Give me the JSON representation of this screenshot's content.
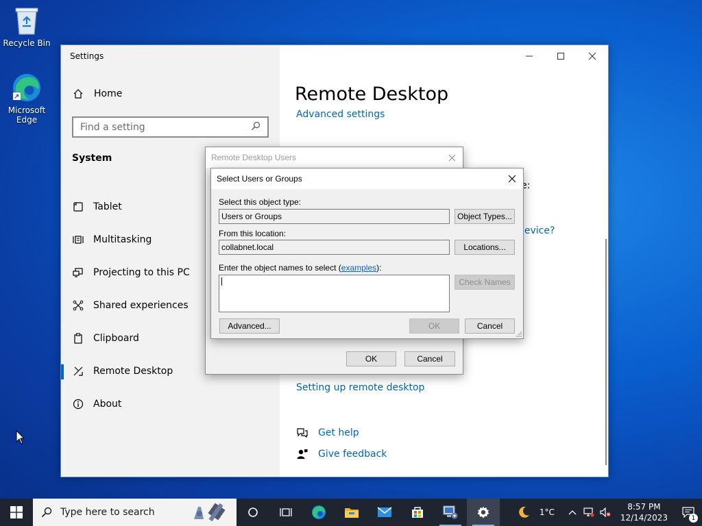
{
  "desktop": {
    "icons": [
      {
        "label": "Recycle Bin"
      },
      {
        "label": "Microsoft Edge"
      }
    ]
  },
  "settings": {
    "app_title": "Settings",
    "home_label": "Home",
    "search_placeholder": "Find a setting",
    "section": "System",
    "nav": [
      {
        "label": "Tablet",
        "icon": "tablet-icon"
      },
      {
        "label": "Multitasking",
        "icon": "multitasking-icon"
      },
      {
        "label": "Projecting to this PC",
        "icon": "projecting-icon"
      },
      {
        "label": "Shared experiences",
        "icon": "shared-experiences-icon"
      },
      {
        "label": "Clipboard",
        "icon": "clipboard-icon"
      },
      {
        "label": "Remote Desktop",
        "icon": "remote-desktop-icon",
        "active": true
      },
      {
        "label": "About",
        "icon": "info-icon"
      }
    ],
    "page_title": "Remote Desktop",
    "advanced_settings": "Advanced settings",
    "partial_colon": "e:",
    "partial_device": "device?",
    "setup_link": "Setting up remote desktop",
    "get_help": "Get help",
    "give_feedback": "Give feedback"
  },
  "rdu_dialog": {
    "title": "Remote Desktop Users",
    "ok": "OK",
    "cancel": "Cancel"
  },
  "sug_dialog": {
    "title": "Select Users or Groups",
    "object_type_label": "Select this object type:",
    "object_type_value": "Users or Groups",
    "object_types_btn": "Object Types...",
    "location_label": "From this location:",
    "location_value": "collabnet.local",
    "locations_btn": "Locations...",
    "enter_label_prefix": "Enter the object names to select (",
    "enter_label_link": "examples",
    "enter_label_suffix": "):",
    "names_value": "",
    "check_names_btn": "Check Names",
    "advanced_btn": "Advanced...",
    "ok": "OK",
    "cancel": "Cancel"
  },
  "taskbar": {
    "search_placeholder": "Type here to search",
    "weather": "1°C",
    "time": "8:57 PM",
    "date": "12/14/2023",
    "notification_count": "1"
  },
  "colors": {
    "accent": "#0067c0",
    "link": "#0066b4",
    "taskbar": "#1f2530"
  }
}
